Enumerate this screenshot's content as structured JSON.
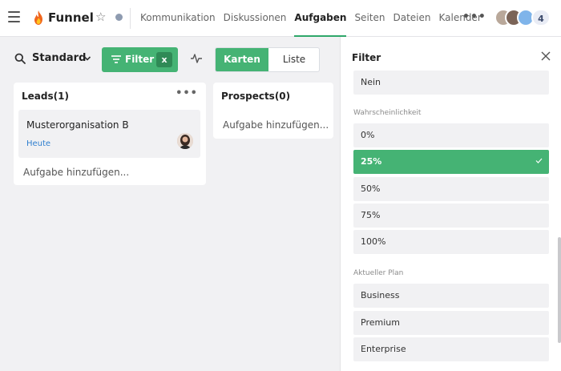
{
  "header": {
    "title": "Funnel",
    "nav": [
      "Kommunikation",
      "Diskussionen",
      "Aufgaben",
      "Seiten",
      "Dateien",
      "Kalender"
    ],
    "active_tab": "Aufgaben",
    "more_label": "•••",
    "member_count": "4"
  },
  "toolbar": {
    "view_name": "Standard",
    "filter_label": "Filter",
    "filter_clear": "x",
    "view_cards": "Karten",
    "view_list": "Liste"
  },
  "columns": [
    {
      "title": "Leads(1)",
      "more_label": "•••",
      "cards": [
        {
          "title": "Musterorganisation B",
          "due": "Heute"
        }
      ],
      "add_task": "Aufgabe hinzufügen..."
    },
    {
      "title": "Prospects(0)",
      "cards": [],
      "add_task": "Aufgabe hinzufügen..."
    }
  ],
  "filter_panel": {
    "title": "Filter",
    "top_option": "Nein",
    "sections": [
      {
        "label": "Wahrscheinlichkeit",
        "options": [
          "0%",
          "25%",
          "50%",
          "75%",
          "100%"
        ],
        "selected": "25%"
      },
      {
        "label": "Aktueller Plan",
        "options": [
          "Business",
          "Premium",
          "Enterprise"
        ],
        "selected": null
      }
    ]
  },
  "colors": {
    "accent": "#45b374",
    "accent_dark": "#2f8a56",
    "link": "#2f7fcf"
  }
}
